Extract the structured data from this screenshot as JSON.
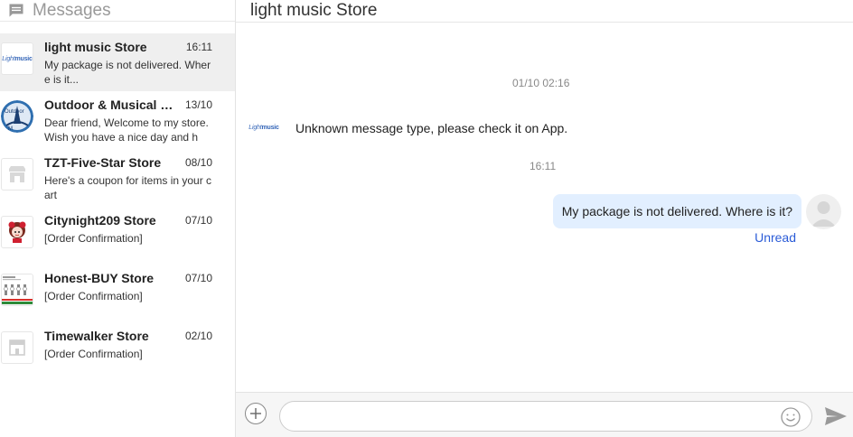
{
  "sidebar": {
    "title": "Messages",
    "conversations": [
      {
        "name": "light music Store",
        "time": "16:11",
        "preview": "My package is not delivered. Where is it...",
        "avatar": "light-music-logo"
      },
      {
        "name": "Outdoor & Musical St...",
        "time": "13/10",
        "preview": "Dear friend, Welcome to my store. Wish you have a nice day and ha...",
        "avatar": "outdoor-musical-logo"
      },
      {
        "name": "TZT-Five-Star Store",
        "time": "08/10",
        "preview": "Here's a coupon for items in your cart",
        "avatar": "store-placeholder-icon"
      },
      {
        "name": "Citynight209 Store",
        "time": "07/10",
        "preview": "[Order Confirmation]",
        "avatar": "citynight-logo"
      },
      {
        "name": "Honest-BUY Store",
        "time": "07/10",
        "preview": "[Order Confirmation]",
        "avatar": "honest-buy-logo"
      },
      {
        "name": "Timewalker Store",
        "time": "02/10",
        "preview": "[Order Confirmation]",
        "avatar": "store-placeholder-icon"
      }
    ]
  },
  "chat": {
    "title": "light music Store",
    "timestamp_1": "01/10 02:16",
    "store_message": "Unknown message type, please check it on App.",
    "timestamp_2": "16:11",
    "my_message": "My package is not delivered. Where is it?",
    "status": "Unread",
    "input": {
      "value": "",
      "placeholder": ""
    }
  },
  "colors": {
    "accent": "#2a5bd7",
    "bubble": "#e2efff",
    "active_row": "#efefef"
  }
}
